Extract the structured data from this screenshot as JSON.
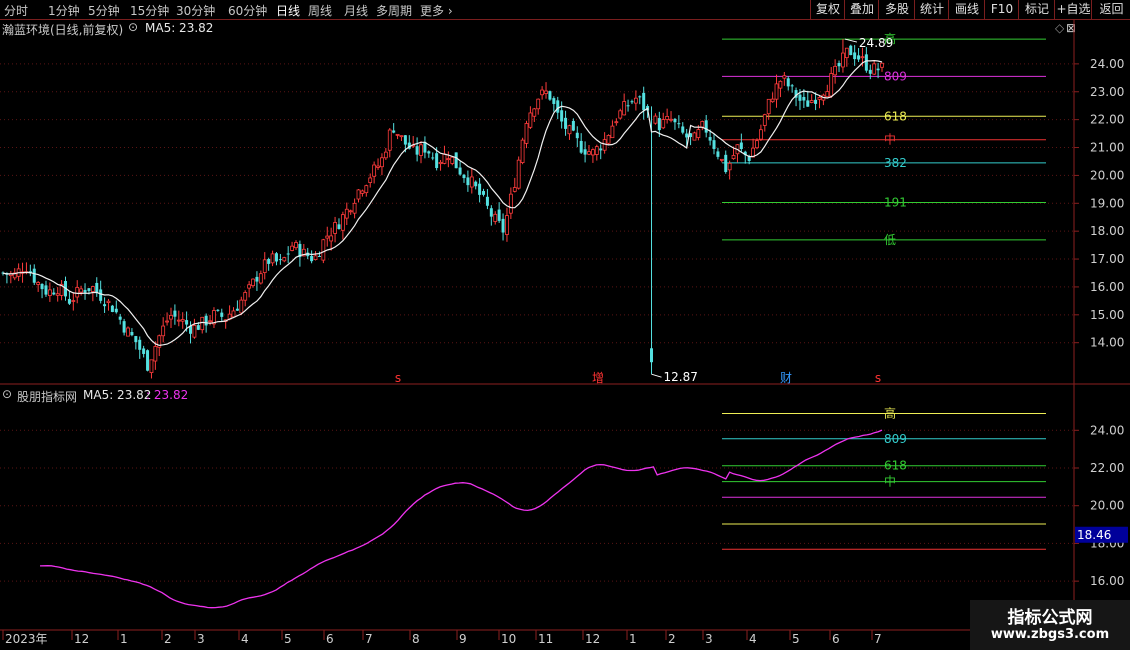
{
  "toolbar": {
    "periods": [
      "分时",
      "1分钟",
      "5分钟",
      "15分钟",
      "30分钟",
      "60分钟",
      "日线",
      "周线",
      "月线",
      "多周期",
      "更多"
    ],
    "active_period": "日线",
    "actions": [
      "复权",
      "叠加",
      "多股",
      "统计",
      "画线",
      "F10",
      "标记",
      "+自选",
      "返回"
    ]
  },
  "main_panel": {
    "stock_label": "瀚蓝环境(日线,前复权)",
    "ma_label": "MA5: 23.82",
    "high_price": "24.89",
    "low_price": "12.87",
    "price_ticks": [
      "24.00",
      "23.00",
      "22.00",
      "21.00",
      "20.00",
      "19.00",
      "18.00",
      "17.00",
      "16.00",
      "15.00",
      "14.00"
    ],
    "fib_levels": [
      {
        "label": "高",
        "color": "#33cc33",
        "value": 24.89
      },
      {
        "label": "809",
        "color": "#dd33dd",
        "value": 23.55
      },
      {
        "label": "618",
        "color": "#eeee55",
        "value": 22.12
      },
      {
        "label": "中",
        "color": "#ee3333",
        "value": 21.28
      },
      {
        "label": "382",
        "color": "#33cccc",
        "value": 20.45
      },
      {
        "label": "191",
        "color": "#33cc33",
        "value": 19.03
      },
      {
        "label": "低",
        "color": "#33cc33",
        "value": 17.69
      }
    ],
    "event_markers": [
      {
        "label": "s",
        "color": "#ff3333"
      },
      {
        "label": "增",
        "color": "#ff3333"
      },
      {
        "label": "财",
        "color": "#3399ff"
      },
      {
        "label": "s",
        "color": "#ff3333"
      }
    ]
  },
  "sub_panel": {
    "indicator_label": "股朋指标网",
    "ma_label": "MA5: 23.82",
    "ma_value_label": ": 23.82",
    "cursor_price": "18.46",
    "price_ticks": [
      "24.00",
      "22.00",
      "20.00",
      "18.00",
      "16.00"
    ],
    "fib_levels": [
      {
        "label": "高",
        "color": "#eeee55",
        "value": 24.89
      },
      {
        "label": "809",
        "color": "#33cccc",
        "value": 23.55
      },
      {
        "label": "618",
        "color": "#33cc33",
        "value": 22.12
      },
      {
        "label": "中",
        "color": "#33cc33",
        "value": 21.28
      },
      {
        "label": "",
        "color": "#dd33dd",
        "value": 20.45
      },
      {
        "label": "",
        "color": "#eeee55",
        "value": 19.03
      },
      {
        "label": "",
        "color": "#ee3333",
        "value": 17.69
      }
    ]
  },
  "time_axis": {
    "labels": [
      "2023年",
      "12",
      "1",
      "2",
      "3",
      "4",
      "5",
      "6",
      "7",
      "8",
      "9",
      "10",
      "11",
      "12",
      "1",
      "2",
      "3",
      "4",
      "5",
      "6",
      "7"
    ]
  },
  "chart_data": {
    "type": "candlestick",
    "series": [
      {
        "name": "瀚蓝环境",
        "ohlc_close": [
          16.5,
          16.4,
          16.8,
          16.2,
          15.8,
          16.0,
          15.5,
          15.9,
          16.0,
          15.6,
          15.2,
          14.5,
          14.0,
          13.2,
          14.2,
          15.0,
          14.8,
          14.5,
          14.7,
          15.0,
          14.9,
          15.3,
          15.8,
          16.5,
          17.0,
          16.8,
          17.5,
          17.2,
          17.0,
          17.8,
          18.2,
          18.8,
          19.5,
          20.0,
          20.5,
          21.8,
          21.2,
          20.8,
          21.0,
          20.5,
          20.8,
          20.2,
          19.8,
          19.2,
          18.5,
          18.0,
          19.8,
          22.0,
          22.8,
          23.0,
          22.0,
          21.5,
          21.0,
          20.8,
          21.2,
          22.0,
          22.5,
          22.8,
          22.2,
          21.8,
          22.0,
          21.5,
          21.2,
          21.8,
          21.0,
          20.2,
          21.0,
          20.6,
          21.5,
          22.8,
          23.5,
          23.0,
          22.5,
          22.8,
          23.2,
          23.8,
          24.5,
          24.2,
          23.8,
          23.82
        ]
      }
    ],
    "ma5_label": "MA5",
    "ma5_last": 23.82,
    "high": 24.89,
    "low": 12.87,
    "sub_indicator": {
      "name": "股朋指标网",
      "ma5_last": 23.82
    },
    "ylim_main": [
      13.2,
      25.0
    ],
    "ylim_sub": [
      15.0,
      25.5
    ],
    "grid": true
  }
}
